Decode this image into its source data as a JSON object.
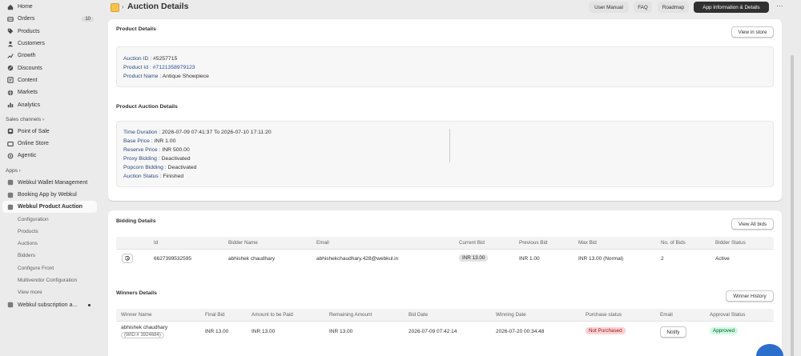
{
  "sidebar": {
    "items": [
      {
        "label": "Home",
        "icon": "home-icon"
      },
      {
        "label": "Orders",
        "icon": "orders-icon",
        "badge": "10"
      },
      {
        "label": "Products",
        "icon": "tag-icon"
      },
      {
        "label": "Customers",
        "icon": "person-icon"
      },
      {
        "label": "Growth",
        "icon": "growth-icon"
      },
      {
        "label": "Discounts",
        "icon": "discount-icon"
      },
      {
        "label": "Content",
        "icon": "content-icon"
      },
      {
        "label": "Markets",
        "icon": "globe-icon"
      },
      {
        "label": "Analytics",
        "icon": "bar-chart-icon"
      }
    ],
    "sales_channels_heading": "Sales channels",
    "sales_channels": [
      {
        "label": "Point of Sale",
        "icon": "pos-icon"
      },
      {
        "label": "Online Store",
        "icon": "store-icon"
      },
      {
        "label": "Agentic",
        "icon": "agentic-icon"
      }
    ],
    "apps_heading": "Apps",
    "apps": [
      {
        "label": "Webkul Wallet Management"
      },
      {
        "label": "Booking App by Webkul"
      },
      {
        "label": "Webkul Product Auction"
      }
    ],
    "sub_items": [
      "Configuration",
      "Products",
      "Auctions",
      "Bidders",
      "Configure Front",
      "Multivendor Configuration",
      "View more"
    ],
    "last_app": "Webkul subscription a..."
  },
  "header": {
    "title": "Auction Details",
    "buttons": [
      "User Manual",
      "FAQ",
      "Roadmap",
      "App Information & Details"
    ],
    "more": "···"
  },
  "product_details": {
    "title": "Product Details",
    "view_button": "View in store",
    "auction_id_label": "Auction ID :",
    "auction_id": "#5257715",
    "product_id_label": "Product Id :",
    "product_id": "#7121358979123",
    "product_name_label": "Product Name :",
    "product_name": "Antique Showpiece"
  },
  "auction_details": {
    "title": "Product Auction Details",
    "time_label": "Time Duration :",
    "time_value": "2026-07-09 07:41:37 To 2026-07-10 17:11:20",
    "base_label": "Base Price :",
    "base_value": "INR 1.00",
    "reserve_label": "Reserve Price :",
    "reserve_value": "INR 500.00",
    "proxy_label": "Proxy Bidding :",
    "proxy_value": "Deactivated",
    "popcorn_label": "Popcorn Bidding :",
    "popcorn_value": "Deactivated",
    "status_label": "Auction Status :",
    "status_value": "Finished"
  },
  "bidding": {
    "title": "Bidding Details",
    "view_button": "View All bids",
    "columns": [
      "Id",
      "Bidder Name",
      "Email",
      "Current Bid",
      "Previous Bid",
      "Max Bid",
      "No. of Bids",
      "Bidder Status"
    ],
    "row": {
      "id": "6627399532595",
      "name": "abhishek chaudhary",
      "email": "abhishekchaudhary.428@webkul.in",
      "current": "INR 13.00",
      "previous": "INR 1.00",
      "max": "INR 13.00 (Normal)",
      "bids": "2",
      "status": "Active"
    }
  },
  "winners": {
    "title": "Winners Details",
    "history_button": "Winner History",
    "columns": [
      "Winner Name",
      "Final Bid",
      "Amount to be Paid",
      "Remaining Amount",
      "Bid Date",
      "Winning Date",
      "Purchase status",
      "Email",
      "Approval Status"
    ],
    "row": {
      "name": "abhishek chaudhary",
      "wid": "(WID:# 3924684)",
      "final": "INR 13.00",
      "to_pay": "INR 13.00",
      "remaining": "INR 13.00",
      "bid_date": "2026-07-09 07:42:14",
      "win_date": "2026-07-20 00:34:48",
      "purchase": "Not Purchased",
      "notify": "Notify",
      "approval": "Approved"
    }
  }
}
